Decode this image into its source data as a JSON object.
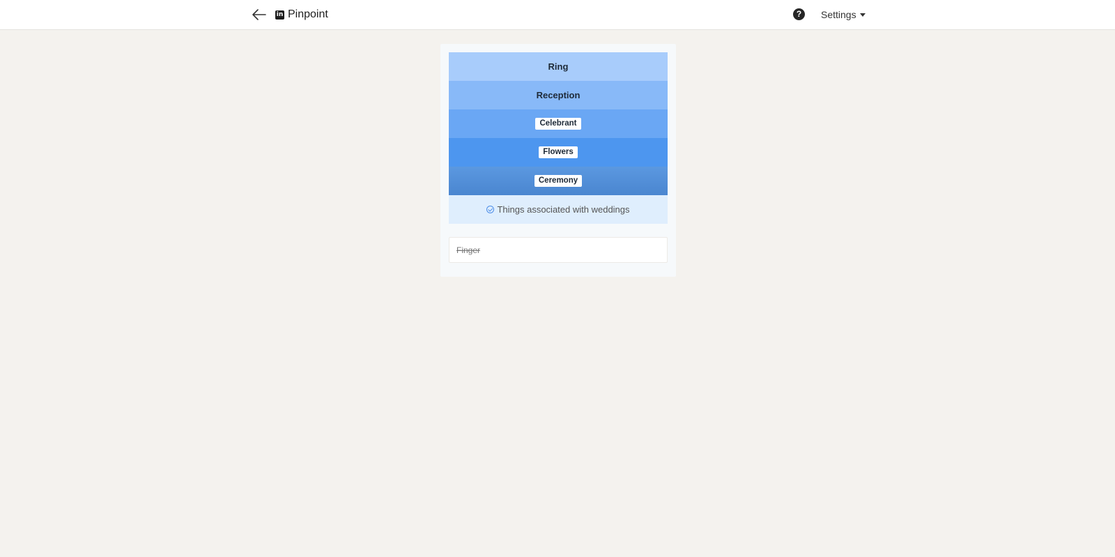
{
  "header": {
    "brand_name": "Pinpoint",
    "brand_logo_text": "in",
    "settings_label": "Settings",
    "help_symbol": "?"
  },
  "puzzle": {
    "clues": [
      {
        "label": "Ring",
        "style": "plain"
      },
      {
        "label": "Reception",
        "style": "plain"
      },
      {
        "label": "Celebrant",
        "style": "chip"
      },
      {
        "label": "Flowers",
        "style": "chip"
      },
      {
        "label": "Ceremony",
        "style": "chip"
      }
    ],
    "answer": "Things associated with weddings",
    "guesses": [
      "Finger"
    ]
  },
  "colors": {
    "accent": "#4d96ef",
    "answer_bg": "#dfeefd"
  },
  "icons": [
    "back-arrow-icon",
    "linkedin-logo-icon",
    "help-icon",
    "check-circle-icon",
    "caret-down-icon"
  ]
}
